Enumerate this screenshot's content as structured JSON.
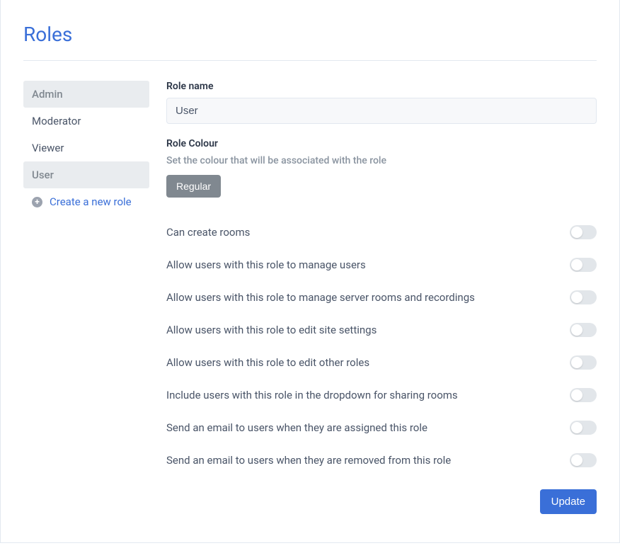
{
  "page": {
    "title": "Roles"
  },
  "sidebar": {
    "roles": [
      {
        "label": "Admin",
        "active": true
      },
      {
        "label": "Moderator",
        "active": false
      },
      {
        "label": "Viewer",
        "active": false
      },
      {
        "label": "User",
        "active": true
      }
    ],
    "create_label": "Create a new role"
  },
  "form": {
    "role_name_label": "Role name",
    "role_name_value": "User",
    "role_colour_label": "Role Colour",
    "role_colour_hint": "Set the colour that will be associated with the role",
    "colour_button": "Regular",
    "update_button": "Update"
  },
  "permissions": [
    {
      "label": "Can create rooms",
      "enabled": false
    },
    {
      "label": "Allow users with this role to manage users",
      "enabled": false
    },
    {
      "label": "Allow users with this role to manage server rooms and recordings",
      "enabled": false
    },
    {
      "label": "Allow users with this role to edit site settings",
      "enabled": false
    },
    {
      "label": "Allow users with this role to edit other roles",
      "enabled": false
    },
    {
      "label": "Include users with this role in the dropdown for sharing rooms",
      "enabled": false
    },
    {
      "label": "Send an email to users when they are assigned this role",
      "enabled": false
    },
    {
      "label": "Send an email to users when they are removed from this role",
      "enabled": false
    }
  ]
}
